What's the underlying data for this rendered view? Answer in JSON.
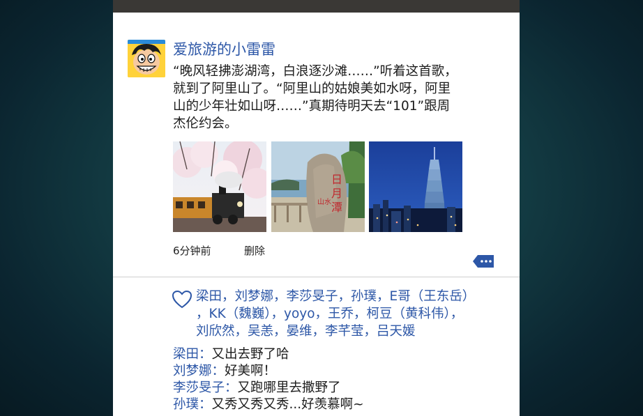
{
  "post": {
    "username": "爱旅游的小雷雷",
    "text_lines": [
      "“晚风轻拂澎湖湾，白浪逐沙滩……”听着这首歌，",
      "就到了阿里山了。“阿里山的姑娘美如水呀，阿里",
      "山的少年壮如山呀……”真期待明天去“101”跟周",
      "杰伦约会。"
    ],
    "time": "6分钟前",
    "delete_label": "删除",
    "photos": [
      "alishan-train-photo",
      "sun-moon-lake-stone-photo",
      "taipei-101-night-photo"
    ]
  },
  "likes": {
    "lines": [
      "梁田，刘梦娜，李莎旻子，孙璞，E哥（王东岳）",
      "，KK（魏巍），yoyo，王乔，柯豆（黄科伟），",
      "刘欣然，吴恙，晏维，李芊莹，吕天媛"
    ]
  },
  "comments": [
    {
      "user": "梁田",
      "sep": "：",
      "text": "又出去野了哈"
    },
    {
      "user": "刘梦娜",
      "sep": "：",
      "text": "好美啊！"
    },
    {
      "user": "李莎旻子",
      "sep": "：",
      "text": "又跑哪里去撒野了"
    },
    {
      "user": "孙璞",
      "sep": "：",
      "text": "又秀又秀又秀...好羡慕啊~"
    }
  ],
  "colors": {
    "link_blue": "#2d57a7",
    "text": "#1c1c1c"
  }
}
